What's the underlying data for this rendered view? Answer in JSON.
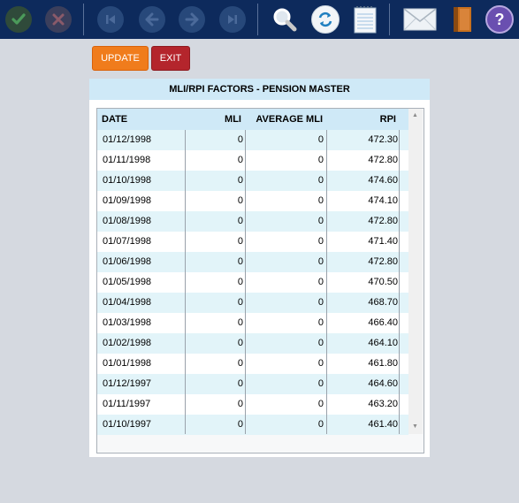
{
  "toolbar": {
    "buttons": [
      {
        "name": "confirm-icon"
      },
      {
        "name": "cancel-icon"
      },
      {
        "name": "first-record-icon"
      },
      {
        "name": "previous-record-icon"
      },
      {
        "name": "next-record-icon"
      },
      {
        "name": "last-record-icon"
      },
      {
        "name": "search-icon"
      },
      {
        "name": "refresh-icon"
      },
      {
        "name": "notepad-icon"
      },
      {
        "name": "mail-icon"
      },
      {
        "name": "book-icon"
      },
      {
        "name": "help-icon"
      }
    ],
    "help_glyph": "?"
  },
  "actions": {
    "update_label": "UPDATE",
    "exit_label": "EXIT"
  },
  "panel": {
    "title": "MLI/RPI FACTORS - PENSION MASTER"
  },
  "grid": {
    "columns": {
      "date": "DATE",
      "mli": "MLI",
      "average_mli": "AVERAGE MLI",
      "rpi": "RPI"
    },
    "rows": [
      {
        "date": "01/12/1998",
        "mli": "0",
        "average_mli": "0",
        "rpi": "472.30"
      },
      {
        "date": "01/11/1998",
        "mli": "0",
        "average_mli": "0",
        "rpi": "472.80"
      },
      {
        "date": "01/10/1998",
        "mli": "0",
        "average_mli": "0",
        "rpi": "474.60"
      },
      {
        "date": "01/09/1998",
        "mli": "0",
        "average_mli": "0",
        "rpi": "474.10"
      },
      {
        "date": "01/08/1998",
        "mli": "0",
        "average_mli": "0",
        "rpi": "472.80"
      },
      {
        "date": "01/07/1998",
        "mli": "0",
        "average_mli": "0",
        "rpi": "471.40"
      },
      {
        "date": "01/06/1998",
        "mli": "0",
        "average_mli": "0",
        "rpi": "472.80"
      },
      {
        "date": "01/05/1998",
        "mli": "0",
        "average_mli": "0",
        "rpi": "470.50"
      },
      {
        "date": "01/04/1998",
        "mli": "0",
        "average_mli": "0",
        "rpi": "468.70"
      },
      {
        "date": "01/03/1998",
        "mli": "0",
        "average_mli": "0",
        "rpi": "466.40"
      },
      {
        "date": "01/02/1998",
        "mli": "0",
        "average_mli": "0",
        "rpi": "464.10"
      },
      {
        "date": "01/01/1998",
        "mli": "0",
        "average_mli": "0",
        "rpi": "461.80"
      },
      {
        "date": "01/12/1997",
        "mli": "0",
        "average_mli": "0",
        "rpi": "464.60"
      },
      {
        "date": "01/11/1997",
        "mli": "0",
        "average_mli": "0",
        "rpi": "463.20"
      },
      {
        "date": "01/10/1997",
        "mli": "0",
        "average_mli": "0",
        "rpi": "461.40"
      }
    ]
  },
  "colors": {
    "toolbar_bg": "#0d2a5c",
    "update_button": "#f07c1c",
    "exit_button": "#b4252c",
    "header_bg": "#cfe9f7",
    "row_alt_bg": "#e2f4f9"
  }
}
